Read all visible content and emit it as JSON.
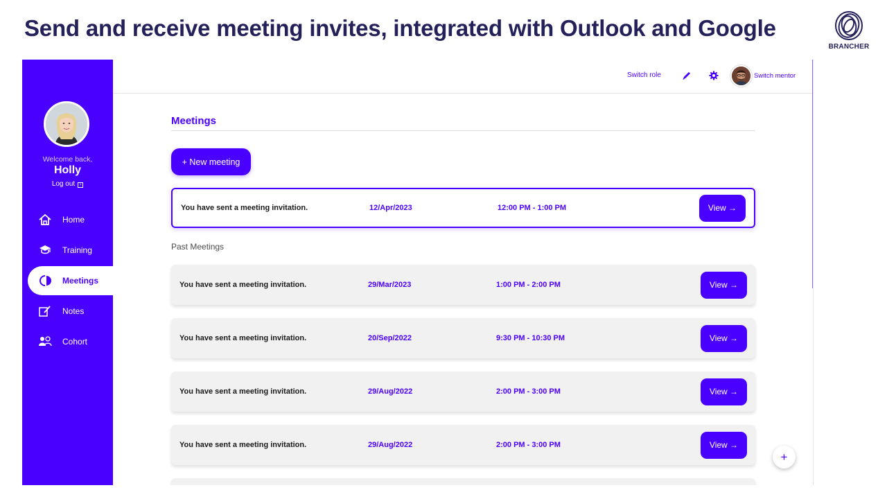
{
  "headline": "Send and receive meeting invites, integrated with Outlook and Google",
  "brand": {
    "name": "BRANCHER",
    "color": "#24215a"
  },
  "theme": {
    "primary": "#4a00ff",
    "card_bg": "#f1f1f1"
  },
  "sidebar": {
    "welcome": "Welcome back,",
    "username": "Holly",
    "logout_label": "Log out",
    "items": [
      {
        "label": "Home",
        "icon": "home-icon",
        "active": false
      },
      {
        "label": "Training",
        "icon": "graduation-cap-icon",
        "active": false
      },
      {
        "label": "Meetings",
        "icon": "meetings-icon",
        "active": true
      },
      {
        "label": "Notes",
        "icon": "notes-icon",
        "active": false
      },
      {
        "label": "Cohort",
        "icon": "cohort-icon",
        "active": false
      }
    ]
  },
  "topbar": {
    "switch_role": "Switch role",
    "switch_mentor": "Switch mentor"
  },
  "main": {
    "title": "Meetings",
    "new_meeting_label": "+  New meeting",
    "past_label": "Past Meetings",
    "upcoming": [
      {
        "description": "You have sent a meeting invitation.",
        "date": "12/Apr/2023",
        "time": "12:00 PM - 1:00 PM",
        "action": "View →"
      }
    ],
    "past": [
      {
        "description": "You have sent a meeting invitation.",
        "date": "29/Mar/2023",
        "time": "1:00 PM - 2:00 PM",
        "action": "View →"
      },
      {
        "description": "You have sent a meeting invitation.",
        "date": "20/Sep/2022",
        "time": "9:30 PM - 10:30 PM",
        "action": "View →"
      },
      {
        "description": "You have sent a meeting invitation.",
        "date": "29/Aug/2022",
        "time": "2:00 PM - 3:00 PM",
        "action": "View →"
      },
      {
        "description": "You have sent a meeting invitation.",
        "date": "29/Aug/2022",
        "time": "2:00 PM - 3:00 PM",
        "action": "View →"
      }
    ]
  },
  "fab_label": "+"
}
